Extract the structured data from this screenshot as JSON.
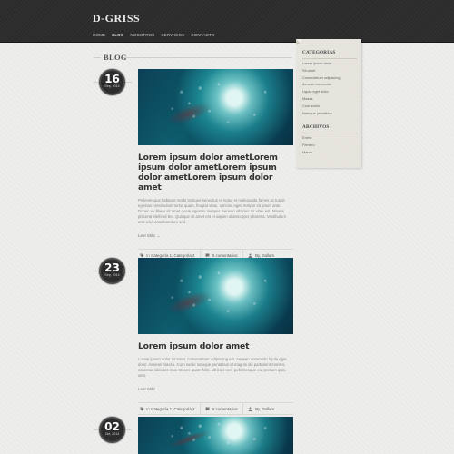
{
  "site": {
    "logo": "D-GRISS"
  },
  "nav": {
    "items": [
      {
        "label": "HOME"
      },
      {
        "label": "BLOG"
      },
      {
        "label": "NOSOTROS"
      },
      {
        "label": "SERVICIOS"
      },
      {
        "label": "CONTACTO"
      }
    ]
  },
  "section": {
    "title": "BLOG"
  },
  "posts": [
    {
      "day": "16",
      "month": "Sep, 2014",
      "title": "Lorem ipsum dolor ametLorem ipsum dolor ametLorem ipsum dolor ametLorem ipsum dolor amet",
      "excerpt": "Pellentesque habitant morbi tristique senectus et netus et malesuada fames ac turpis egestas. Vestibulum tortor quam, feugiat vitae, ultricies eget, tempor sit amet, ante. Donec eu libero sit amet quam egestas semper. Aenean ultricies mi vitae est. Mauris placerat eleifend leo. Quisque sit amet est et sapien ullamcorper pharetra. Vestibulum erat wisi, condimentum sed.",
      "read_more": "Leer Más →",
      "categories_prefix": "In",
      "categories": "Categoría 1, Categoría 2",
      "comments": "5 comentarios",
      "author": "By, Dallum"
    },
    {
      "day": "23",
      "month": "Sep, 2014",
      "title": "Lorem ipsum dolor amet",
      "excerpt": "Lorem ipsum dolor sit amet, consectetuer adipiscing elit. Aenean commodo ligula eget dolor. Aenean massa. Cum sociis natoque penatibus et magnis dis parturient montes, nascetur ridiculus mus. Donec quam felis, ultricies nec, pellentesque eu, pretium quis, sem.",
      "read_more": "Leer Más →",
      "categories_prefix": "In",
      "categories": "Categoría 1, Categoría 2",
      "comments": "5 comentarios",
      "author": "By, Dallum"
    },
    {
      "day": "02",
      "month": "Oct, 2014"
    }
  ],
  "sidebar": {
    "categories_title": "CATEGORIAS",
    "categories": [
      "Lorem ipsum dolor",
      "Sit amet",
      "Consectetuer adipiscing",
      "Aenean commodo",
      "Ligula eget dolor",
      "Massa",
      "Cum sociis",
      "Natoque penatibus"
    ],
    "archives_title": "ARCHIVOS",
    "archives": [
      "Enero",
      "Febrero",
      "Marzo"
    ]
  },
  "colors": {
    "header_bg": "#2b2b2b",
    "page_bg": "#ededeb",
    "sidebar_bg": "#e8e5df",
    "badge_bg": "#2d2d2d"
  }
}
